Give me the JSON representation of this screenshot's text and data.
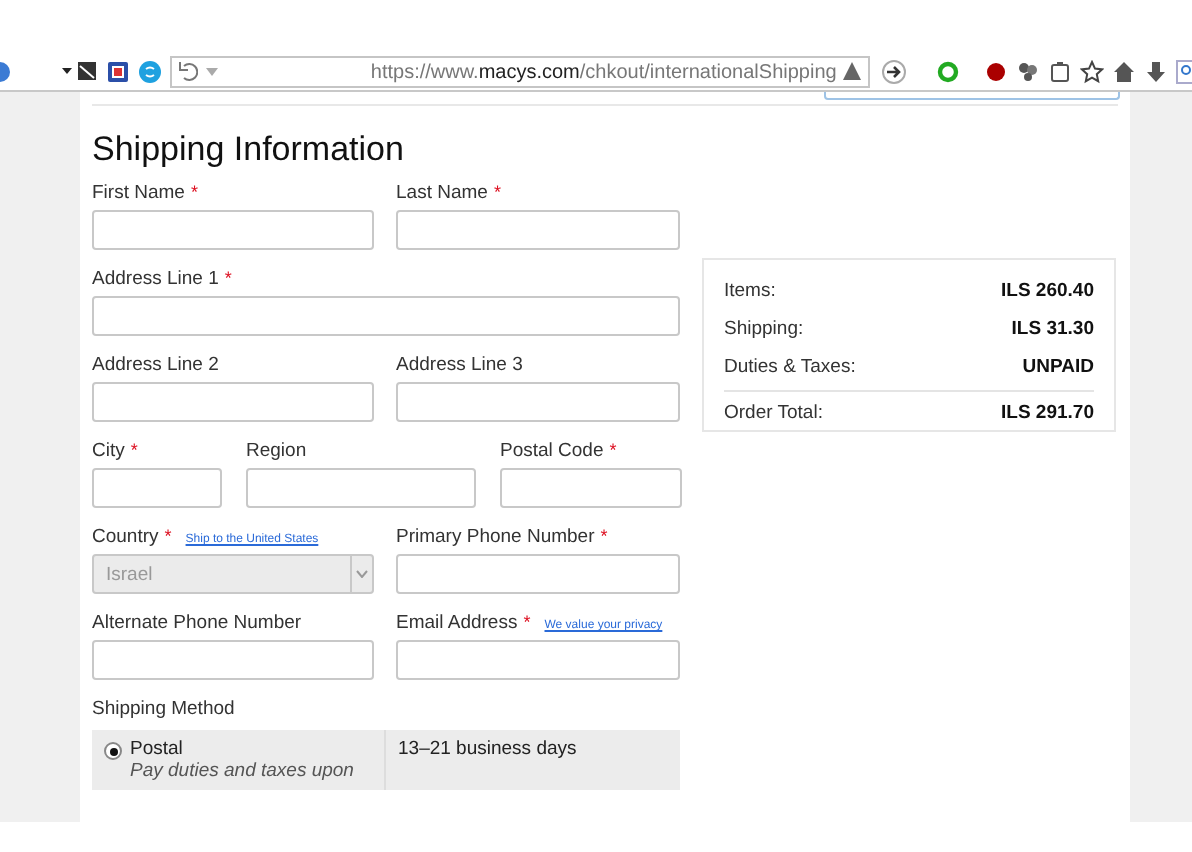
{
  "browser": {
    "url_host": "https://www.",
    "url_domain": "macys.com",
    "url_path": "/chkout/internationalShipping"
  },
  "form": {
    "title": "Shipping Information",
    "rows": [
      [
        {
          "label": "First Name",
          "required": true,
          "kind": "text"
        },
        {
          "label": "Last Name",
          "required": true,
          "kind": "text"
        }
      ],
      [
        {
          "label": "Address Line 1",
          "required": true,
          "kind": "text"
        }
      ],
      [
        {
          "label": "Address Line 2",
          "required": false,
          "kind": "text"
        },
        {
          "label": "Address Line 3",
          "required": false,
          "kind": "text"
        }
      ],
      [
        {
          "label": "City",
          "required": true,
          "kind": "text"
        },
        {
          "label": "Region",
          "required": false,
          "kind": "text"
        },
        {
          "label": "Postal Code",
          "required": true,
          "kind": "text"
        }
      ],
      [
        {
          "label": "Country",
          "required": true,
          "kind": "select",
          "link": "Ship to the United States",
          "value": "Israel",
          "disabled": true
        },
        {
          "label": "Primary Phone Number",
          "required": true,
          "kind": "text"
        }
      ],
      [
        {
          "label": "Alternate Phone Number",
          "required": false,
          "kind": "text"
        },
        {
          "label": "Email Address",
          "required": true,
          "kind": "text",
          "link": "We value your privacy"
        }
      ]
    ],
    "required_mark": "*",
    "shipping_method": {
      "label": "Shipping Method",
      "options": [
        {
          "name": "Postal",
          "note": "Pay duties and taxes upon",
          "time": "13–21 business days",
          "selected": true
        }
      ]
    }
  },
  "summary": {
    "lines": [
      {
        "label": "Items:",
        "value": "ILS 260.40"
      },
      {
        "label": "Shipping:",
        "value": "ILS 31.30"
      },
      {
        "label": "Duties & Taxes:",
        "value": "UNPAID"
      }
    ],
    "total": {
      "label": "Order Total:",
      "value": "ILS 291.70"
    }
  }
}
